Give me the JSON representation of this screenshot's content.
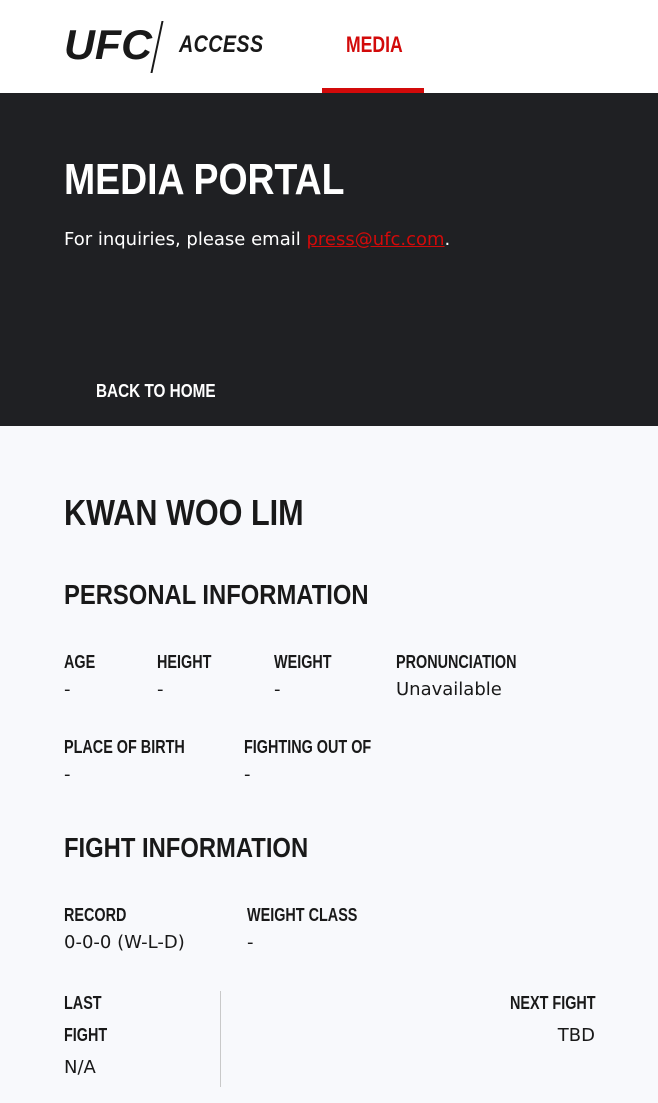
{
  "header": {
    "brand": "UFC",
    "sub_brand": "ACCESS",
    "nav": {
      "media_label": "MEDIA"
    }
  },
  "hero": {
    "title": "MEDIA PORTAL",
    "inquiry_prefix": "For inquiries, please email ",
    "email": "press@ufc.com",
    "inquiry_suffix": ".",
    "back_label": "BACK TO HOME"
  },
  "athlete": {
    "name": "KWAN WOO LIM",
    "personal_heading": "PERSONAL INFORMATION",
    "personal": {
      "age_label": "AGE",
      "age": "-",
      "height_label": "HEIGHT",
      "height": "-",
      "weight_label": "WEIGHT",
      "weight": "-",
      "pronunciation_label": "PRONUNCIATION",
      "pronunciation": "Unavailable",
      "birth_label": "PLACE OF BIRTH",
      "birth": "-",
      "fighting_out_of_label": "FIGHTING OUT OF",
      "fighting_out_of": "-"
    },
    "fight_heading": "FIGHT INFORMATION",
    "fight": {
      "record_label": "RECORD",
      "record": "0-0-0 (W-L-D)",
      "weight_class_label": "WEIGHT CLASS",
      "weight_class": "-",
      "last_fight_label_1": "LAST",
      "last_fight_label_2": "FIGHT",
      "last_fight": "N/A",
      "next_fight_label": "NEXT FIGHT",
      "next_fight": "TBD"
    }
  },
  "colors": {
    "accent": "#d20a0a",
    "hero_bg": "#1f2023",
    "page_bg": "#f8f9fc"
  }
}
